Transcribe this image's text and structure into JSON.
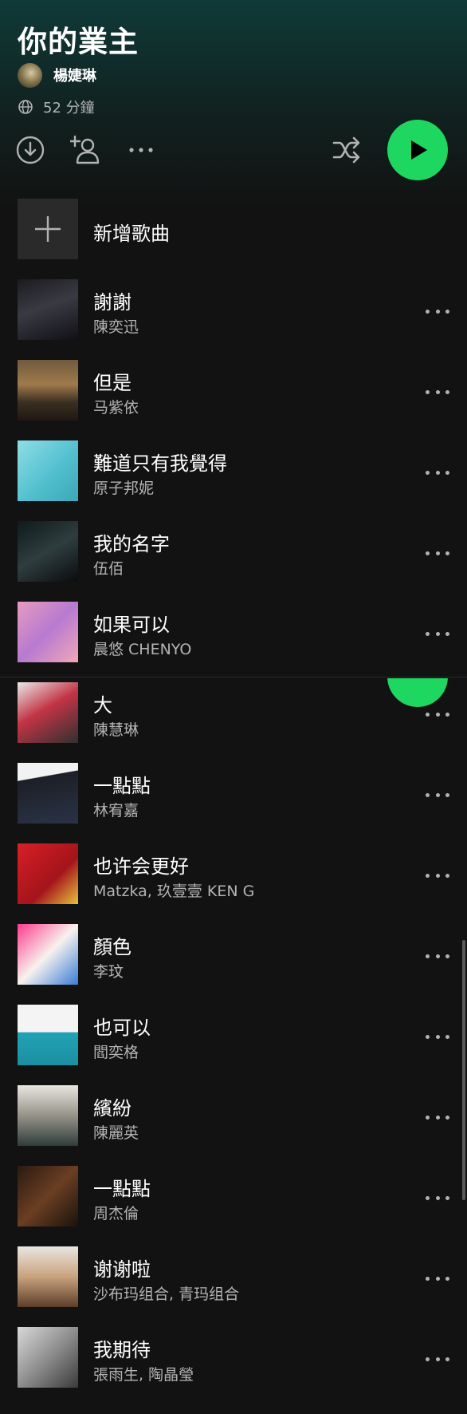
{
  "playlist": {
    "title": "你的業主",
    "owner": "楊婕琳",
    "duration": "52 分鐘"
  },
  "icons": {
    "globe": "globe-icon",
    "download": "download-icon",
    "add_user": "add-user-icon",
    "more": "more-icon",
    "shuffle": "shuffle-icon",
    "play": "play-icon",
    "plus": "plus-icon"
  },
  "colors": {
    "accent": "#1ed760",
    "background": "#121212",
    "secondary_text": "#b3b3b3"
  },
  "add_song": {
    "label": "新增歌曲"
  },
  "tracks": [
    {
      "title": "謝謝",
      "artist": "陳奕迅"
    },
    {
      "title": "但是",
      "artist": "马紫依"
    },
    {
      "title": "難道只有我覺得",
      "artist": "原子邦妮"
    },
    {
      "title": "我的名字",
      "artist": "伍佰"
    },
    {
      "title": "如果可以",
      "artist": "晨悠 CHENYO"
    },
    {
      "title": "大",
      "artist": "陳慧琳"
    },
    {
      "title": "一點點",
      "artist": "林宥嘉"
    },
    {
      "title": "也许会更好",
      "artist": "Matzka, 玖壹壹 KEN G"
    },
    {
      "title": "顏色",
      "artist": "李玟"
    },
    {
      "title": "也可以",
      "artist": "閻奕格"
    },
    {
      "title": "繽紛",
      "artist": "陳麗英"
    },
    {
      "title": "一點點",
      "artist": "周杰倫"
    },
    {
      "title": "谢谢啦",
      "artist": "沙布玛组合, 青玛组合"
    },
    {
      "title": "我期待",
      "artist": "張雨生, 陶晶瑩"
    }
  ]
}
